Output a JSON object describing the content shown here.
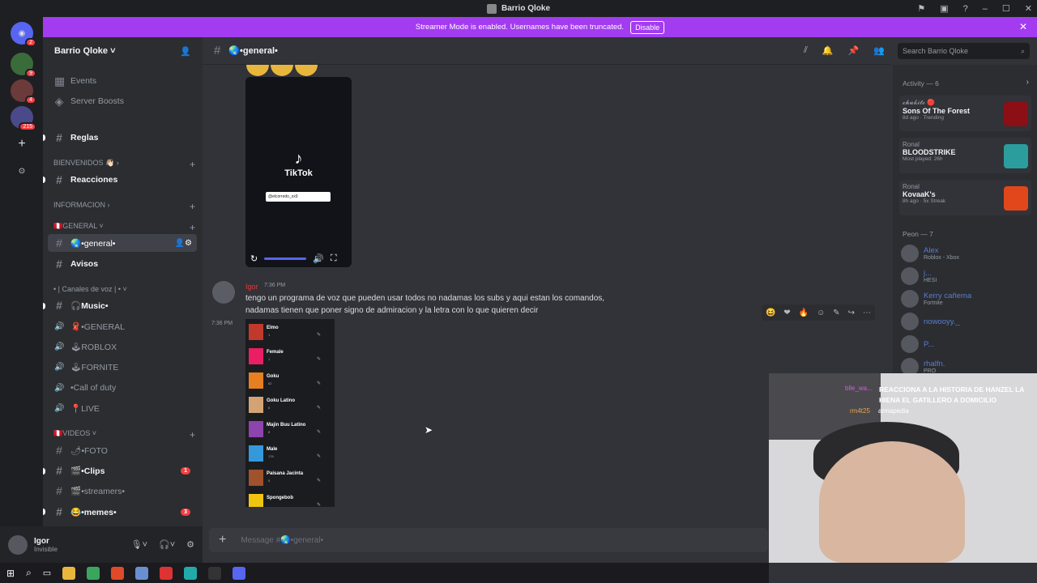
{
  "titlebar": {
    "title": "Barrio Qloke"
  },
  "banner": {
    "text": "Streamer Mode is enabled. Usernames have been truncated.",
    "disable": "Disable"
  },
  "guilds": [
    {
      "label": "",
      "badge": "2"
    },
    {
      "label": "",
      "badge": "9"
    },
    {
      "label": "",
      "badge": "4"
    },
    {
      "label": "",
      "badge": "215"
    }
  ],
  "server": {
    "name": "Barrio Qloke ˅"
  },
  "channels": {
    "events": "Events",
    "boosts": "Server Boosts",
    "reglas": "Reglas",
    "cat_bienvenidos": "BIENVENIDOS 👋🏻 ›",
    "reacciones": "Reacciones",
    "cat_informacion": "INFORMACION ›",
    "cat_general": "🇵🇪General ˅",
    "general": "🌏•general•",
    "avisos": "Avisos",
    "cat_voz": "• | Canales de voz | • ˅",
    "music": "🎧Music•",
    "v_general": "🧣•GENERAL",
    "v_roblox": "🕹ROBLOX",
    "v_fornite": "🕹FORNITE",
    "v_cod": "•Call of duty",
    "v_live": "📍LIVE",
    "cat_videos": "🇵🇪VIDEOS ˅",
    "foto": "🌶•FOTO",
    "clips": "🎬•Clips",
    "clips_badge": "1",
    "streamers": "🎬•streamers•",
    "memes": "😂•memes•",
    "memes_badge": "3"
  },
  "user": {
    "name": "Igor",
    "status": "Invisible"
  },
  "header": {
    "channel": "🌏•general•"
  },
  "search": {
    "placeholder": "Search Barrio Qloke"
  },
  "video": {
    "brand": "TikTok",
    "handle": "@elcorredo_xx9"
  },
  "message": {
    "author": "Igor",
    "time": "7:36 PM",
    "text": "tengo un programa de voz que pueden usar todos no nadamas los subs y aqui estan los comandos, nadamas tienen que poner signo de admiracion y la letra con lo que quieren decir",
    "side_time": "7:36 PM"
  },
  "sounds": [
    {
      "name": "Elmo",
      "count": "1"
    },
    {
      "name": "Female",
      "count": "1"
    },
    {
      "name": "Goku",
      "count": "62"
    },
    {
      "name": "Goku Latino",
      "count": "6"
    },
    {
      "name": "Majin Buu Latino",
      "count": "8"
    },
    {
      "name": "Male",
      "count": "176"
    },
    {
      "name": "Paisana Jacinta",
      "count": "5"
    },
    {
      "name": "Spongebob",
      "count": ""
    }
  ],
  "composer": {
    "placeholder": "Message #🌏•general•"
  },
  "activity": {
    "header": "Activity — 6",
    "cards": [
      {
        "who": "𝓬𝓱𝓾𝓴𝓲𝓽𝓸 🔴",
        "game": "Sons Of The Forest",
        "meta": "8d ago · Trending",
        "color": "#8b0f14"
      },
      {
        "who": "Ronal",
        "game": "BLOODSTRIKE",
        "meta": "Most played: 26h",
        "color": "#2a9d9c"
      },
      {
        "who": "Ronal",
        "game": "KovaaK's",
        "meta": "8h ago · 5x Streak",
        "color": "#e2471b"
      }
    ]
  },
  "members": {
    "header": "Peon — 7",
    "list": [
      {
        "name": "Alex",
        "sub": "Roblox - Xbox"
      },
      {
        "name": "j...",
        "sub": "HESI"
      },
      {
        "name": "Kerry cañema",
        "sub": "Fortnite"
      },
      {
        "name": "nowooyy._",
        "sub": ""
      },
      {
        "name": "P...",
        "sub": ""
      },
      {
        "name": "rhalfn.",
        "sub": "PRO"
      }
    ]
  },
  "stream": {
    "headline": "REACCIONA A LA HISTORIA DE HANZEL LA HIENA EL GATILLERO A DOMICILIO",
    "chat1": "blle_wa...",
    "chat2": "rm4t25",
    "chat2b": "armapedia"
  }
}
